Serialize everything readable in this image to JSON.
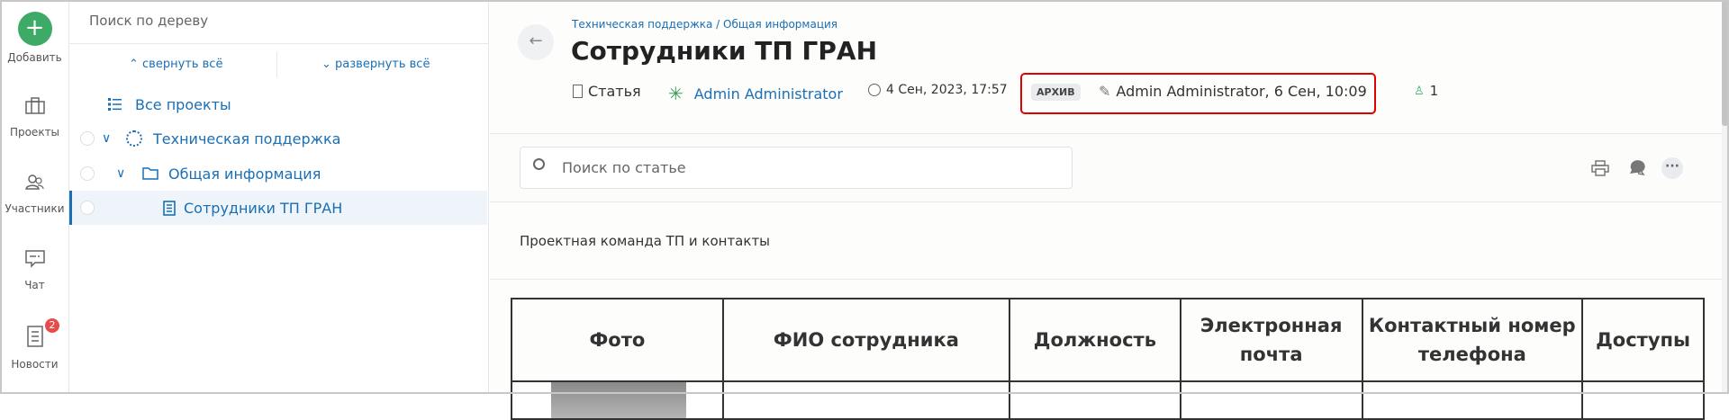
{
  "rail": {
    "add": "Добавить",
    "projects": "Проекты",
    "members": "Участники",
    "chat": "Чат",
    "news": "Новости",
    "news_badge": "2"
  },
  "tree": {
    "search_placeholder": "Поиск по дереву",
    "collapse_all": "свернуть всё",
    "expand_all": "развернуть всё",
    "all_projects": "Все проекты",
    "items": [
      {
        "label": "Техническая поддержка"
      },
      {
        "label": "Общая информация"
      },
      {
        "label": "Сотрудники ТП ГРАН"
      }
    ]
  },
  "article": {
    "breadcrumb": "Техническая поддержка / Общая информация",
    "title": "Сотрудники ТП ГРАН",
    "type": "Статья",
    "author": "Admin Administrator",
    "created": "4 Сен, 2023, 17:57",
    "status_badge": "АРХИВ",
    "edited": "Admin Administrator, 6 Сен, 10:09",
    "watchers": "1",
    "search_placeholder": "Поиск по статье",
    "intro": "Проектная команда ТП и контакты",
    "table_headers": [
      "Фото",
      "ФИО сотрудника",
      "Должность",
      "Электронная почта",
      "Контактный номер телефона",
      "Доступы"
    ]
  },
  "colors": {
    "accent": "#1a6fb5",
    "add_button": "#3daa67",
    "highlight": "#e00000",
    "badge": "#e54c4c"
  }
}
